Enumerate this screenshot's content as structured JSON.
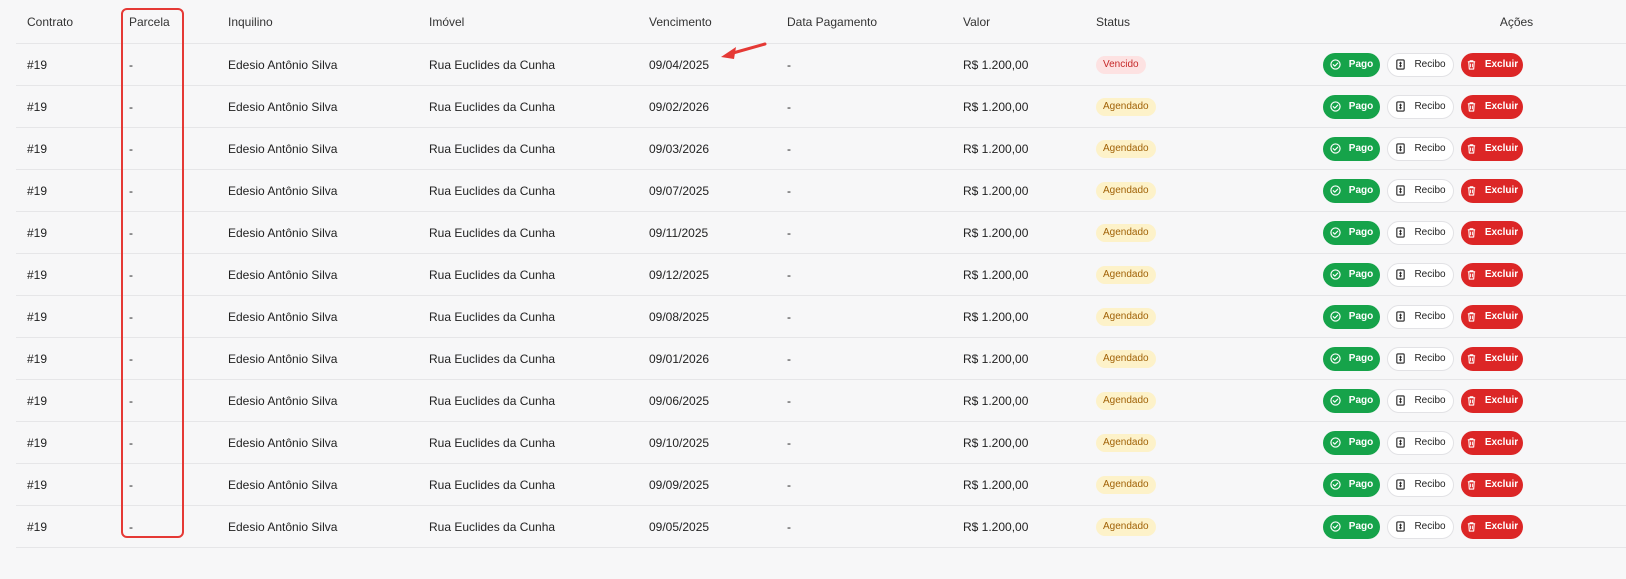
{
  "columns": {
    "contrato": "Contrato",
    "parcela": "Parcela",
    "inquilino": "Inquilino",
    "imovel": "Imóvel",
    "vencimento": "Vencimento",
    "data_pagamento": "Data Pagamento",
    "valor": "Valor",
    "status": "Status",
    "acoes": "Ações"
  },
  "buttons": {
    "pago": "Pago",
    "recibo": "Recibo",
    "excluir": "Excluir"
  },
  "icons": {
    "pago": "check-circle-icon",
    "recibo": "receipt-icon",
    "excluir": "trash-icon"
  },
  "colors": {
    "pago": "#16a34a",
    "excluir": "#dc2626",
    "vencido_bg": "#fde2e2",
    "agendado_bg": "#fdf2c9",
    "annotation": "#e53935"
  },
  "rows": [
    {
      "contrato": "#19",
      "parcela": "-",
      "inquilino": "Edesio Antônio Silva",
      "imovel": "Rua Euclides da Cunha",
      "vencimento": "09/04/2025",
      "data_pagamento": "-",
      "valor": "R$ 1.200,00",
      "status": "Vencido",
      "status_kind": "vencido"
    },
    {
      "contrato": "#19",
      "parcela": "-",
      "inquilino": "Edesio Antônio Silva",
      "imovel": "Rua Euclides da Cunha",
      "vencimento": "09/02/2026",
      "data_pagamento": "-",
      "valor": "R$ 1.200,00",
      "status": "Agendado",
      "status_kind": "agendado"
    },
    {
      "contrato": "#19",
      "parcela": "-",
      "inquilino": "Edesio Antônio Silva",
      "imovel": "Rua Euclides da Cunha",
      "vencimento": "09/03/2026",
      "data_pagamento": "-",
      "valor": "R$ 1.200,00",
      "status": "Agendado",
      "status_kind": "agendado"
    },
    {
      "contrato": "#19",
      "parcela": "-",
      "inquilino": "Edesio Antônio Silva",
      "imovel": "Rua Euclides da Cunha",
      "vencimento": "09/07/2025",
      "data_pagamento": "-",
      "valor": "R$ 1.200,00",
      "status": "Agendado",
      "status_kind": "agendado"
    },
    {
      "contrato": "#19",
      "parcela": "-",
      "inquilino": "Edesio Antônio Silva",
      "imovel": "Rua Euclides da Cunha",
      "vencimento": "09/11/2025",
      "data_pagamento": "-",
      "valor": "R$ 1.200,00",
      "status": "Agendado",
      "status_kind": "agendado"
    },
    {
      "contrato": "#19",
      "parcela": "-",
      "inquilino": "Edesio Antônio Silva",
      "imovel": "Rua Euclides da Cunha",
      "vencimento": "09/12/2025",
      "data_pagamento": "-",
      "valor": "R$ 1.200,00",
      "status": "Agendado",
      "status_kind": "agendado"
    },
    {
      "contrato": "#19",
      "parcela": "-",
      "inquilino": "Edesio Antônio Silva",
      "imovel": "Rua Euclides da Cunha",
      "vencimento": "09/08/2025",
      "data_pagamento": "-",
      "valor": "R$ 1.200,00",
      "status": "Agendado",
      "status_kind": "agendado"
    },
    {
      "contrato": "#19",
      "parcela": "-",
      "inquilino": "Edesio Antônio Silva",
      "imovel": "Rua Euclides da Cunha",
      "vencimento": "09/01/2026",
      "data_pagamento": "-",
      "valor": "R$ 1.200,00",
      "status": "Agendado",
      "status_kind": "agendado"
    },
    {
      "contrato": "#19",
      "parcela": "-",
      "inquilino": "Edesio Antônio Silva",
      "imovel": "Rua Euclides da Cunha",
      "vencimento": "09/06/2025",
      "data_pagamento": "-",
      "valor": "R$ 1.200,00",
      "status": "Agendado",
      "status_kind": "agendado"
    },
    {
      "contrato": "#19",
      "parcela": "-",
      "inquilino": "Edesio Antônio Silva",
      "imovel": "Rua Euclides da Cunha",
      "vencimento": "09/10/2025",
      "data_pagamento": "-",
      "valor": "R$ 1.200,00",
      "status": "Agendado",
      "status_kind": "agendado"
    },
    {
      "contrato": "#19",
      "parcela": "-",
      "inquilino": "Edesio Antônio Silva",
      "imovel": "Rua Euclides da Cunha",
      "vencimento": "09/09/2025",
      "data_pagamento": "-",
      "valor": "R$ 1.200,00",
      "status": "Agendado",
      "status_kind": "agendado"
    },
    {
      "contrato": "#19",
      "parcela": "-",
      "inquilino": "Edesio Antônio Silva",
      "imovel": "Rua Euclides da Cunha",
      "vencimento": "09/05/2025",
      "data_pagamento": "-",
      "valor": "R$ 1.200,00",
      "status": "Agendado",
      "status_kind": "agendado"
    }
  ]
}
